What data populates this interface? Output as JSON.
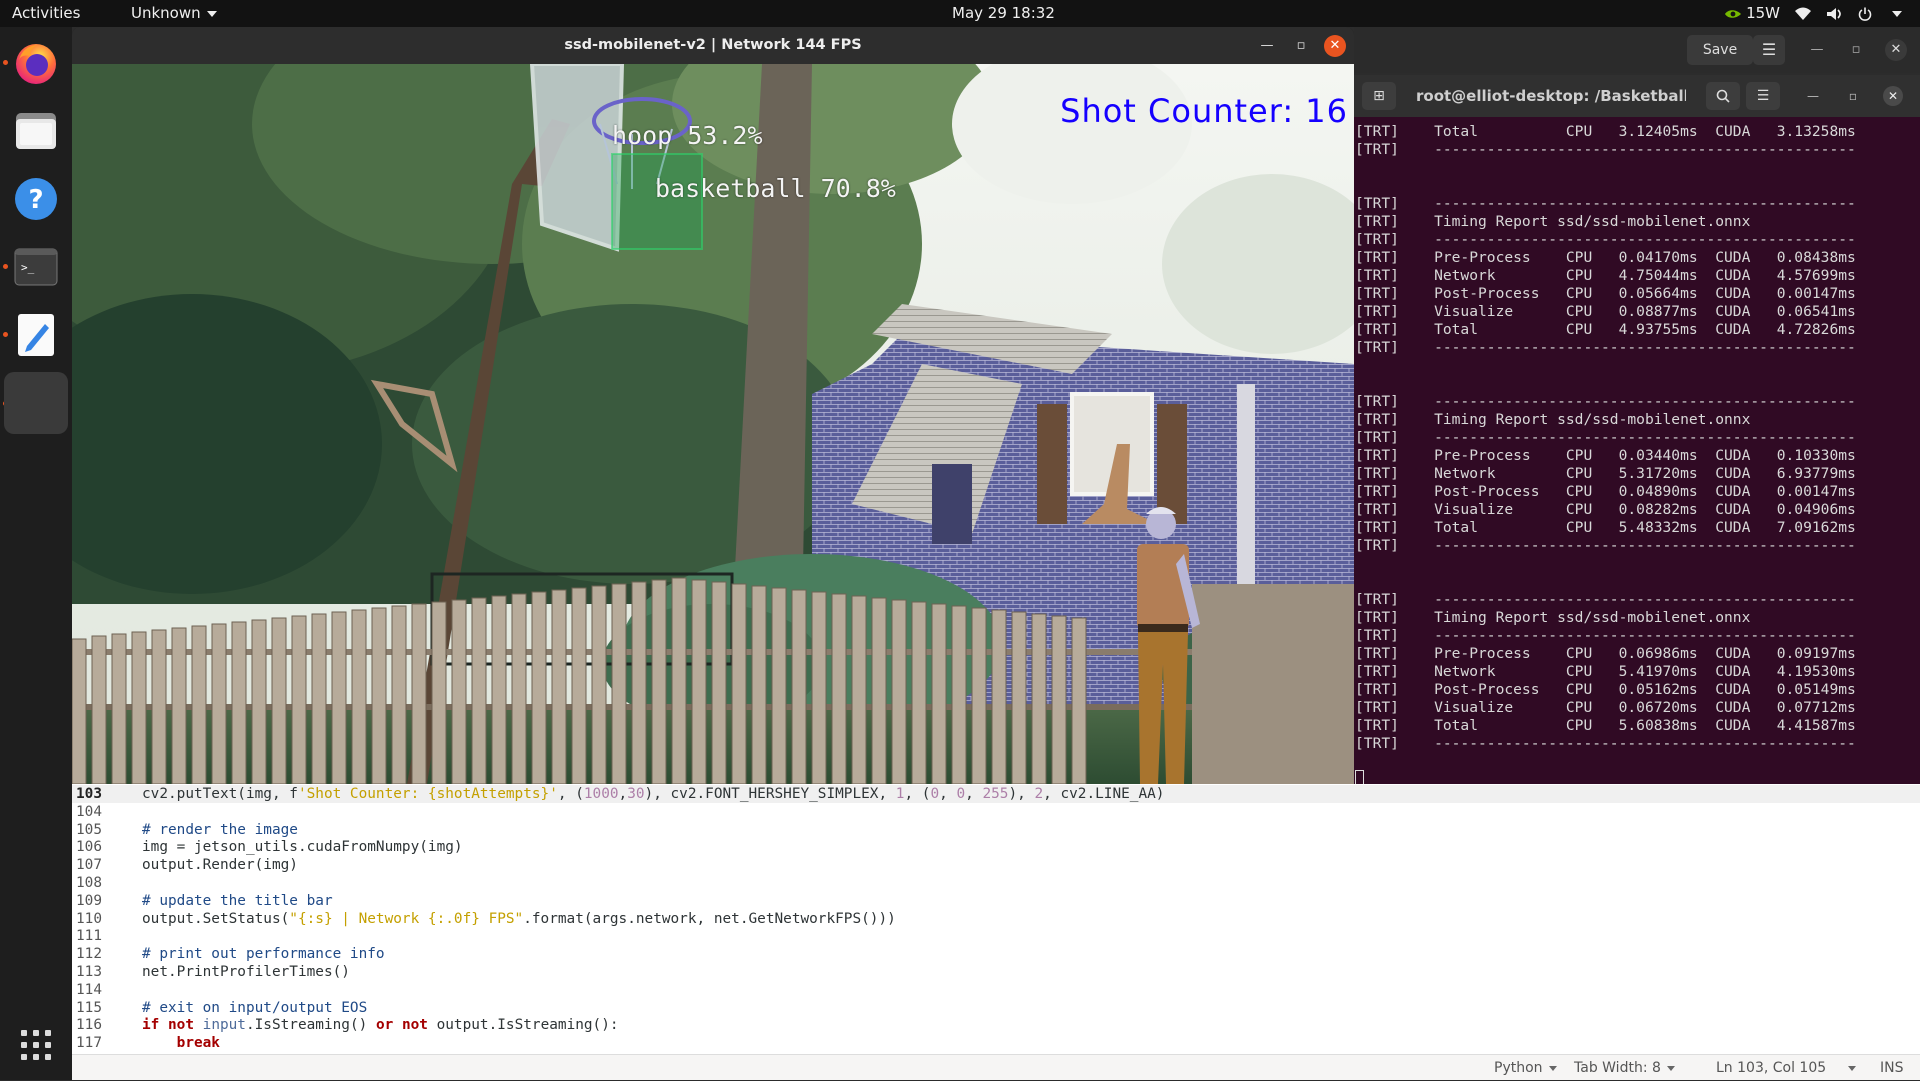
{
  "topbar": {
    "activities": "Activities",
    "app_menu": "Unknown",
    "clock": "May 29  18:32",
    "power_label": "15W"
  },
  "dock": {
    "apps": [
      "firefox-icon",
      "files-icon",
      "help-icon",
      "terminal-icon",
      "text-editor-icon",
      "active-window-icon"
    ]
  },
  "video_window": {
    "title": "ssd-mobilenet-v2 | Network 144 FPS",
    "shot_counter": "Shot Counter: 16",
    "detections": [
      {
        "label": "hoop 53.2%"
      },
      {
        "label": "basketball 70.8%"
      }
    ]
  },
  "gedit": {
    "save_label": "Save"
  },
  "terminal": {
    "title": "root@elliot-desktop: /Basketball-Tr...",
    "lines": [
      "[TRT]    Total          CPU   3.12405ms  CUDA   3.13258ms",
      "[TRT]    ------------------------------------------------",
      "",
      "",
      "[TRT]    ------------------------------------------------",
      "[TRT]    Timing Report ssd/ssd-mobilenet.onnx",
      "[TRT]    ------------------------------------------------",
      "[TRT]    Pre-Process    CPU   0.04170ms  CUDA   0.08438ms",
      "[TRT]    Network        CPU   4.75044ms  CUDA   4.57699ms",
      "[TRT]    Post-Process   CPU   0.05664ms  CUDA   0.00147ms",
      "[TRT]    Visualize      CPU   0.08877ms  CUDA   0.06541ms",
      "[TRT]    Total          CPU   4.93755ms  CUDA   4.72826ms",
      "[TRT]    ------------------------------------------------",
      "",
      "",
      "[TRT]    ------------------------------------------------",
      "[TRT]    Timing Report ssd/ssd-mobilenet.onnx",
      "[TRT]    ------------------------------------------------",
      "[TRT]    Pre-Process    CPU   0.03440ms  CUDA   0.10330ms",
      "[TRT]    Network        CPU   5.31720ms  CUDA   6.93779ms",
      "[TRT]    Post-Process   CPU   0.04890ms  CUDA   0.00147ms",
      "[TRT]    Visualize      CPU   0.08282ms  CUDA   0.04906ms",
      "[TRT]    Total          CPU   5.48332ms  CUDA   7.09162ms",
      "[TRT]    ------------------------------------------------",
      "",
      "",
      "[TRT]    ------------------------------------------------",
      "[TRT]    Timing Report ssd/ssd-mobilenet.onnx",
      "[TRT]    ------------------------------------------------",
      "[TRT]    Pre-Process    CPU   0.06986ms  CUDA   0.09197ms",
      "[TRT]    Network        CPU   5.41970ms  CUDA   4.19530ms",
      "[TRT]    Post-Process   CPU   0.05162ms  CUDA   0.05149ms",
      "[TRT]    Visualize      CPU   0.06720ms  CUDA   0.07712ms",
      "[TRT]    Total          CPU   5.60838ms  CUDA   4.41587ms",
      "[TRT]    ------------------------------------------------"
    ]
  },
  "editor": {
    "lines": [
      {
        "num": "103",
        "current": true,
        "tokens": [
          [
            "",
            "cv2.putText(img, f"
          ],
          [
            "str",
            "'Shot Counter: {shotAttempts}'"
          ],
          [
            "",
            ", ("
          ],
          [
            "num",
            "1000"
          ],
          [
            "",
            ","
          ],
          [
            "num",
            "30"
          ],
          [
            "",
            "), cv2.FONT_HERSHEY_SIMPLEX, "
          ],
          [
            "num",
            "1"
          ],
          [
            "",
            ", ("
          ],
          [
            "num",
            "0"
          ],
          [
            "",
            ", "
          ],
          [
            "num",
            "0"
          ],
          [
            "",
            ", "
          ],
          [
            "num",
            "255"
          ],
          [
            "",
            "), "
          ],
          [
            "num",
            "2"
          ],
          [
            "",
            ", cv2.LINE_AA)"
          ]
        ]
      },
      {
        "num": "104",
        "tokens": []
      },
      {
        "num": "105",
        "tokens": [
          [
            "com",
            "# render the image"
          ]
        ]
      },
      {
        "num": "106",
        "tokens": [
          [
            "",
            "img = jetson_utils.cudaFromNumpy(img)"
          ]
        ]
      },
      {
        "num": "107",
        "tokens": [
          [
            "",
            "output.Render(img)"
          ]
        ]
      },
      {
        "num": "108",
        "tokens": []
      },
      {
        "num": "109",
        "tokens": [
          [
            "com",
            "# update the title bar"
          ]
        ]
      },
      {
        "num": "110",
        "tokens": [
          [
            "",
            "output.SetStatus("
          ],
          [
            "str",
            "\"{:s} | Network {:.0f} FPS\""
          ],
          [
            "",
            ".format(args.network, net.GetNetworkFPS()))"
          ]
        ]
      },
      {
        "num": "111",
        "tokens": []
      },
      {
        "num": "112",
        "tokens": [
          [
            "com",
            "# print out performance info"
          ]
        ]
      },
      {
        "num": "113",
        "tokens": [
          [
            "",
            "net.PrintProfilerTimes()"
          ]
        ]
      },
      {
        "num": "114",
        "tokens": []
      },
      {
        "num": "115",
        "tokens": [
          [
            "com",
            "# exit on input/output EOS"
          ]
        ]
      },
      {
        "num": "116",
        "tokens": [
          [
            "kw",
            "if not "
          ],
          [
            "bi",
            "input"
          ],
          [
            "",
            ".IsStreaming() "
          ],
          [
            "kw",
            "or not "
          ],
          [
            "",
            "output.IsStreaming():"
          ]
        ]
      },
      {
        "num": "117",
        "tokens": [
          [
            "kw",
            "    break"
          ]
        ]
      }
    ]
  },
  "statusbar": {
    "language": "Python",
    "tab_width": "Tab Width: 8",
    "position": "Ln 103, Col 105",
    "mode": "INS"
  },
  "colors": {
    "ubuntu_orange": "#e95420",
    "terminal_bg": "#300a24",
    "shot_counter": "#1500ff"
  }
}
